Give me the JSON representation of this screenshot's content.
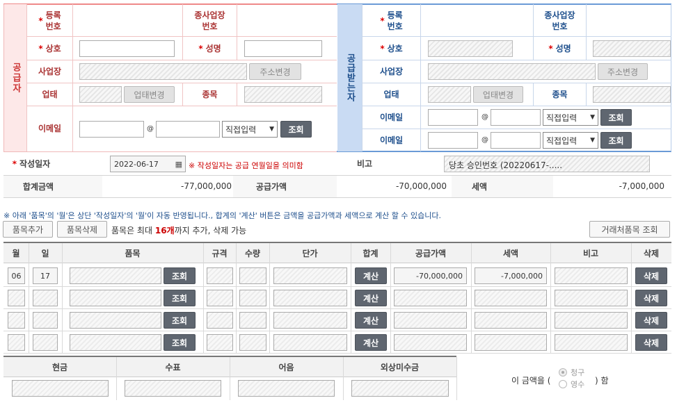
{
  "supplier": {
    "side_label": "공급자",
    "reg_no_label": "등록\n번호",
    "workplace_no_label": "종사업장\n번호",
    "name_label": "상호",
    "ceo_label": "성명",
    "address_label": "사업장",
    "address_change": "주소변경",
    "biz_type_label": "업태",
    "biz_type_change": "업태변경",
    "item_label": "종목",
    "email_label": "이메일",
    "email_at": "@",
    "email_domain_option": "직접입력",
    "lookup": "조회"
  },
  "receiver": {
    "side_label": "공급받는자",
    "reg_no_label": "등록\n번호",
    "workplace_no_label": "종사업장\n번호",
    "name_label": "상호",
    "ceo_label": "성명",
    "address_label": "사업장",
    "address_change": "주소변경",
    "biz_type_label": "업태",
    "biz_type_change": "업태변경",
    "item_label": "종목",
    "email_label": "이메일",
    "email_at": "@",
    "email_domain_option": "직접입력",
    "lookup": "조회",
    "email2_label": "이메일",
    "email2_at": "@",
    "email2_domain_option": "직접입력",
    "lookup2": "조회"
  },
  "write_date": {
    "label": "작성일자",
    "value": "2022-06-17",
    "note": "※ 작성일자는 공급 연월일을 의미함",
    "remarks_label": "비고",
    "remarks_value": "당초 승인번호 (20220617-....."
  },
  "totals": {
    "total_label": "합계금액",
    "total_value": "-77,000,000",
    "supply_label": "공급가액",
    "supply_value": "-70,000,000",
    "tax_label": "세액",
    "tax_value": "-7,000,000"
  },
  "notice": "※ 아래 '품목'의 '월'은 상단 '작성일자'의 '월'이 자동 반영됩니다., 합계의 '계산' 버튼은 금액을 공급가액과 세액으로 계산 할 수 있습니다.",
  "items_toolbar": {
    "add": "품목추가",
    "delete": "품목삭제",
    "info_prefix": "품목은 최대 ",
    "info_count": "16개",
    "info_suffix": "까지 추가, 삭제 가능",
    "partner_lookup": "거래처품목 조회"
  },
  "table": {
    "headers": [
      "월",
      "일",
      "품목",
      "규격",
      "수량",
      "단가",
      "합계",
      "공급가액",
      "세액",
      "비고",
      "삭제"
    ],
    "row1": {
      "month": "06",
      "day": "17",
      "supply": "-70,000,000",
      "tax": "-7,000,000"
    },
    "lookup": "조회",
    "calc": "계산",
    "delete": "삭제"
  },
  "payment": {
    "cash": "현금",
    "check": "수표",
    "note": "어음",
    "credit": "외상미수금",
    "sentence_prefix": "이 금액을 (",
    "option_claim": "청구",
    "option_receipt": "영수",
    "sentence_suffix": ") 함"
  },
  "colors": {
    "supplier_accent": "#f4a6a6",
    "receiver_accent": "#8fb2e0",
    "dark_button": "#5f6670"
  }
}
